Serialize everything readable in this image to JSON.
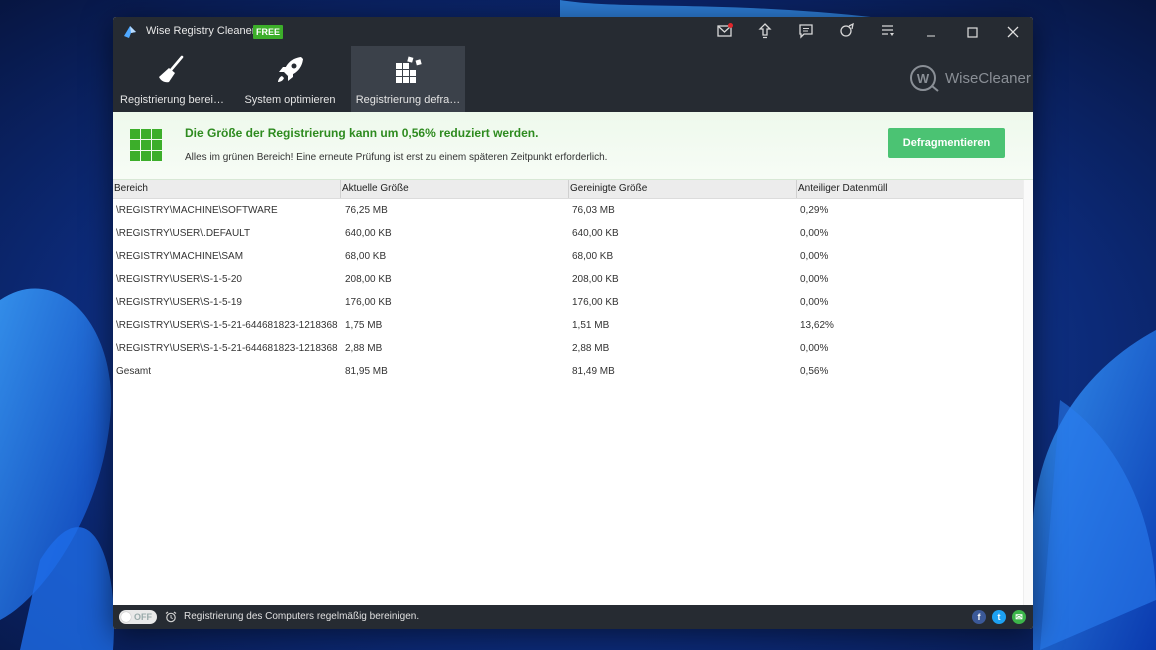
{
  "window": {
    "title": "Wise Registry Cleaner X",
    "badge": "FREE"
  },
  "toolbar_icons": [
    "mail-icon",
    "upload-icon",
    "feedback-icon",
    "skin-icon",
    "menu-icon"
  ],
  "tabs": [
    {
      "label": "Registrierung berei…",
      "icon": "broom-icon",
      "active": false
    },
    {
      "label": "System optimieren",
      "icon": "rocket-icon",
      "active": false
    },
    {
      "label": "Registrierung defra…",
      "icon": "defrag-blocks-icon",
      "active": true
    }
  ],
  "brand": {
    "text": "WiseCleaner"
  },
  "banner": {
    "headline": "Die Größe der Registrierung kann um 0,56% reduziert werden.",
    "subtext": "Alles im grünen Bereich! Eine erneute Prüfung ist erst zu einem späteren Zeitpunkt erforderlich.",
    "button_label": "Defragmentieren",
    "accent": "#4bc373"
  },
  "table": {
    "columns": [
      "Bereich",
      "Aktuelle Größe",
      "Gereinigte Größe",
      "Anteiliger Datenmüll"
    ],
    "rows": [
      [
        "\\REGISTRY\\MACHINE\\SOFTWARE",
        "76,25 MB",
        "76,03 MB",
        "0,29%"
      ],
      [
        "\\REGISTRY\\USER\\.DEFAULT",
        "640,00 KB",
        "640,00 KB",
        "0,00%"
      ],
      [
        "\\REGISTRY\\MACHINE\\SAM",
        "68,00 KB",
        "68,00 KB",
        "0,00%"
      ],
      [
        "\\REGISTRY\\USER\\S-1-5-20",
        "208,00 KB",
        "208,00 KB",
        "0,00%"
      ],
      [
        "\\REGISTRY\\USER\\S-1-5-19",
        "176,00 KB",
        "176,00 KB",
        "0,00%"
      ],
      [
        "\\REGISTRY\\USER\\S-1-5-21-644681823-1218368…",
        "1,75 MB",
        "1,51 MB",
        "13,62%"
      ],
      [
        "\\REGISTRY\\USER\\S-1-5-21-644681823-1218368…",
        "2,88 MB",
        "2,88 MB",
        "0,00%"
      ],
      [
        "Gesamt",
        "81,95 MB",
        "81,49 MB",
        "0,56%"
      ]
    ]
  },
  "statusbar": {
    "toggle_label": "OFF",
    "text": "Registrierung des Computers regelmäßig bereinigen."
  },
  "social": [
    {
      "name": "facebook-icon",
      "glyph": "f",
      "color": "#3b5998"
    },
    {
      "name": "twitter-icon",
      "glyph": "t",
      "color": "#1da1f2"
    },
    {
      "name": "email-share-icon",
      "glyph": "✉",
      "color": "#3cb54a"
    }
  ]
}
